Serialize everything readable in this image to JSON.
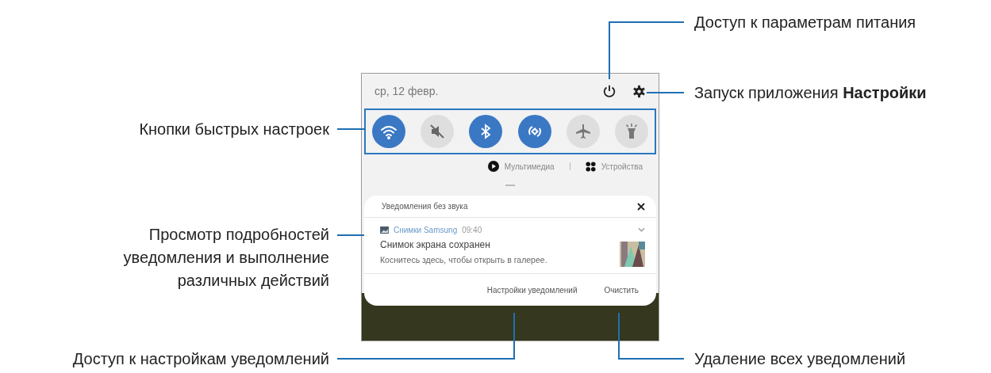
{
  "phone": {
    "date": "ср, 12 февр.",
    "quick_settings": [
      {
        "kind": "wifi",
        "on": true
      },
      {
        "kind": "sound",
        "on": false
      },
      {
        "kind": "bluetooth",
        "on": true
      },
      {
        "kind": "sync",
        "on": true
      },
      {
        "kind": "airplane",
        "on": false
      },
      {
        "kind": "flashlight",
        "on": false
      }
    ],
    "media_row": {
      "media": "Мультимедиа",
      "devices": "Устройства"
    },
    "notification_panel": {
      "header": "Уведомления без звука",
      "app": "Снимки Samsung",
      "time": "09:40",
      "title": "Снимок экрана сохранен",
      "text": "Коснитесь здесь, чтобы открыть в галерее.",
      "actions": [
        "Настройки уведомлений",
        "Очистить"
      ]
    }
  },
  "callouts": [
    "Доступ к параметрам питания",
    "Запуск приложения **Настройки**",
    "Кнопки быстрых настроек",
    "Просмотр подробностей уведомления и выполнение различных действий",
    "Доступ к настройкам уведомлений",
    "Удаление всех уведомлений"
  ]
}
